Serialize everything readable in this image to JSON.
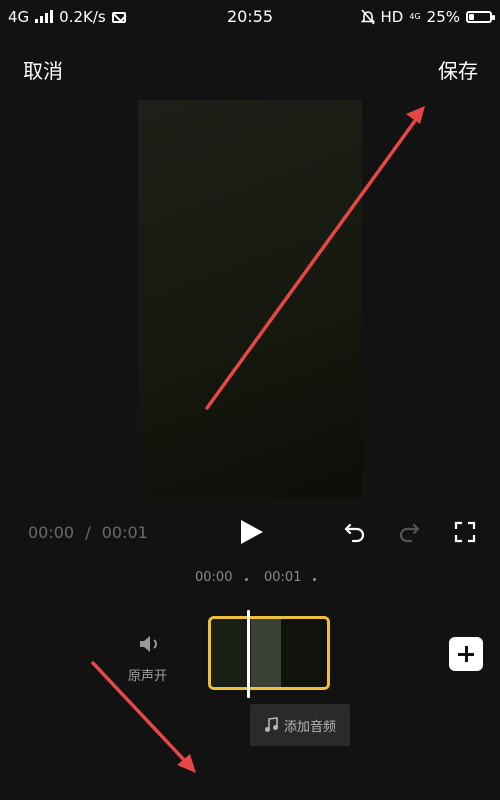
{
  "status_bar": {
    "network": "4G",
    "speed": "0.2K/s",
    "time": "20:55",
    "hd": "HD",
    "net_small": "4G",
    "battery": "25%"
  },
  "top_nav": {
    "cancel": "取消",
    "save": "保存"
  },
  "player": {
    "current_time": "00:00",
    "separator": "/",
    "total_time": "00:01"
  },
  "ruler": {
    "ticks": [
      "00:00",
      "00:01"
    ]
  },
  "timeline": {
    "audio_label": "原声开",
    "add_audio": "添加音频"
  },
  "colors": {
    "background": "#121212",
    "clip_border": "#f0bf3a",
    "annotation_arrow": "#e64646"
  },
  "battery_level": 0.25
}
